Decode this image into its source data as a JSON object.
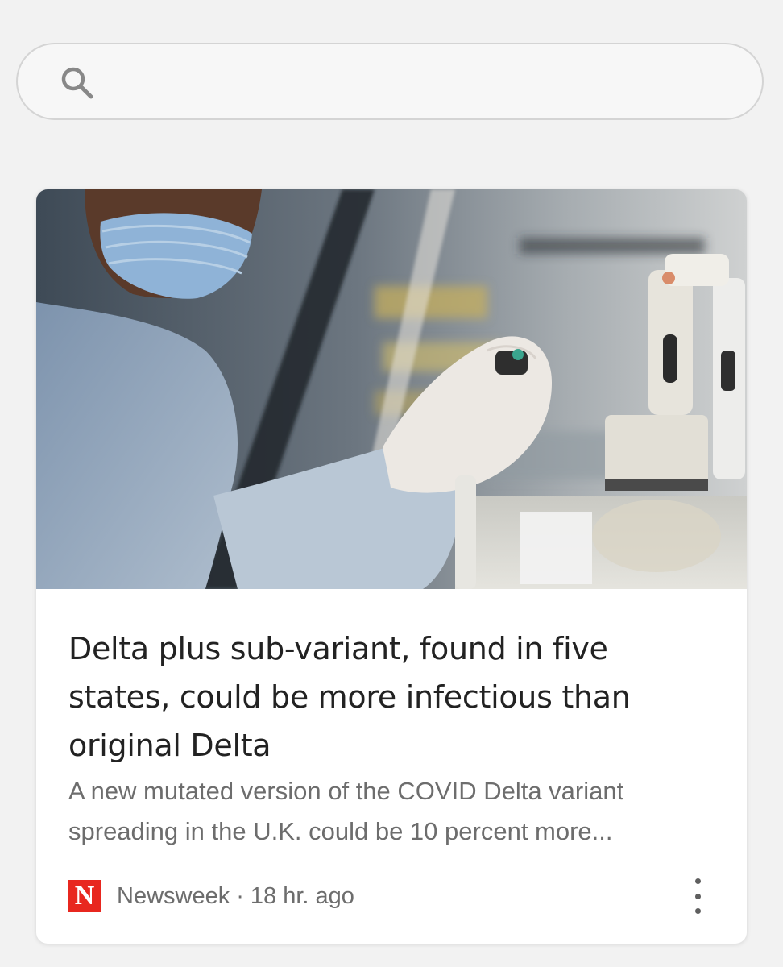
{
  "search": {
    "value": "",
    "placeholder": "",
    "icon": "search-icon"
  },
  "article": {
    "image_description": "",
    "headline": "Delta plus sub-variant, found in five states, could be more infectious than original Delta",
    "snippet": "A new mutated version of the COVID Delta variant spreading in the U.K. could be 10 percent more...",
    "source": {
      "logo_letter": "N",
      "logo_color": "#e8271f",
      "name": "Newsweek",
      "separator": "·",
      "time": "18 hr. ago"
    },
    "more_icon": "more-vert-icon"
  }
}
